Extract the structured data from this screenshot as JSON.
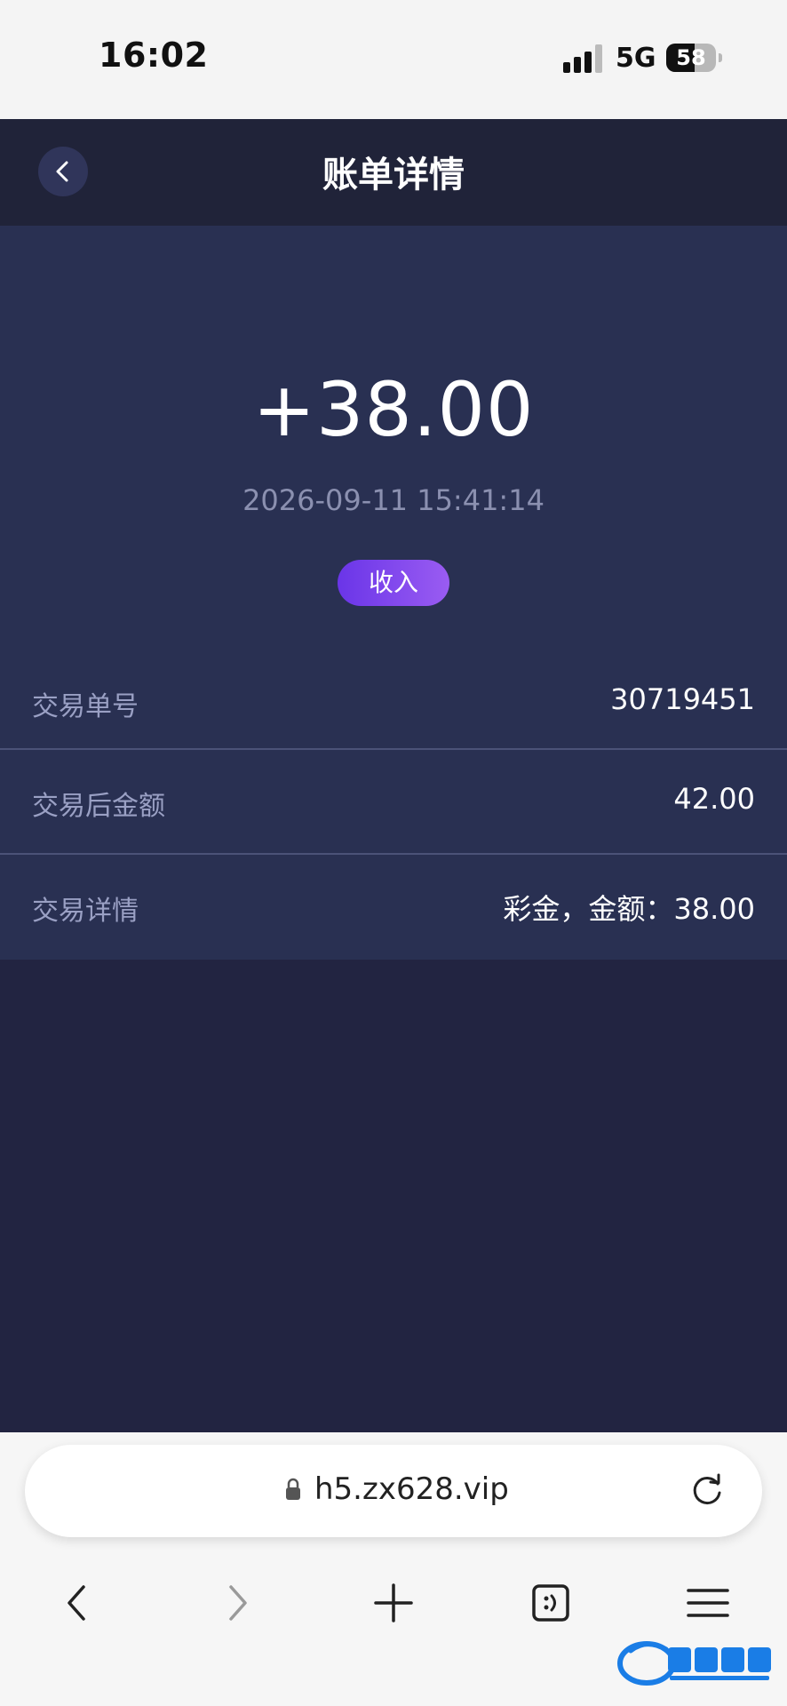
{
  "status_bar": {
    "time": "16:02",
    "network": "5G",
    "battery": "58",
    "battery_level": 0.58
  },
  "nav": {
    "title": "账单详情"
  },
  "transaction": {
    "amount": "+38.00",
    "datetime": "2026-09-11 15:41:14",
    "type_badge": "收入"
  },
  "details": [
    {
      "label": "交易单号",
      "value": "30719451"
    },
    {
      "label": "交易后金额",
      "value": "42.00"
    },
    {
      "label": "交易详情",
      "value": "彩金，金额：38.00"
    }
  ],
  "browser": {
    "url": "h5.zx628.vip"
  },
  "colors": {
    "nav_bg": "#202339",
    "card_bg": "#293052",
    "page_bg": "#222441",
    "badge_start": "#6a35e8",
    "badge_end": "#9a5cf2"
  }
}
